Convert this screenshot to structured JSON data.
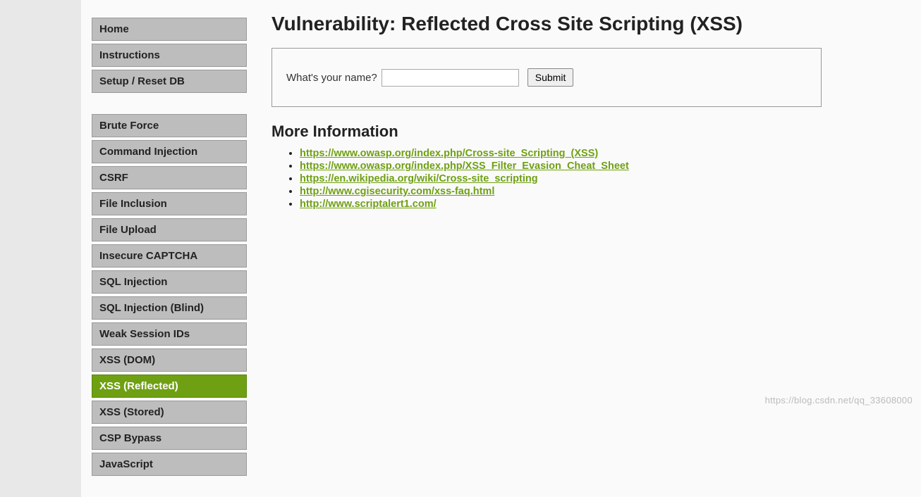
{
  "sidebar": {
    "group1": [
      {
        "label": "Home",
        "name": "nav-home"
      },
      {
        "label": "Instructions",
        "name": "nav-instructions"
      },
      {
        "label": "Setup / Reset DB",
        "name": "nav-setup-reset-db"
      }
    ],
    "group2": [
      {
        "label": "Brute Force",
        "name": "nav-brute-force",
        "selected": false
      },
      {
        "label": "Command Injection",
        "name": "nav-command-injection",
        "selected": false
      },
      {
        "label": "CSRF",
        "name": "nav-csrf",
        "selected": false
      },
      {
        "label": "File Inclusion",
        "name": "nav-file-inclusion",
        "selected": false
      },
      {
        "label": "File Upload",
        "name": "nav-file-upload",
        "selected": false
      },
      {
        "label": "Insecure CAPTCHA",
        "name": "nav-insecure-captcha",
        "selected": false
      },
      {
        "label": "SQL Injection",
        "name": "nav-sql-injection",
        "selected": false
      },
      {
        "label": "SQL Injection (Blind)",
        "name": "nav-sql-injection-blind",
        "selected": false
      },
      {
        "label": "Weak Session IDs",
        "name": "nav-weak-session-ids",
        "selected": false
      },
      {
        "label": "XSS (DOM)",
        "name": "nav-xss-dom",
        "selected": false
      },
      {
        "label": "XSS (Reflected)",
        "name": "nav-xss-reflected",
        "selected": true
      },
      {
        "label": "XSS (Stored)",
        "name": "nav-xss-stored",
        "selected": false
      },
      {
        "label": "CSP Bypass",
        "name": "nav-csp-bypass",
        "selected": false
      },
      {
        "label": "JavaScript",
        "name": "nav-javascript",
        "selected": false
      }
    ]
  },
  "main": {
    "title": "Vulnerability: Reflected Cross Site Scripting (XSS)",
    "form": {
      "label": "What's your name?",
      "input_value": "",
      "submit_label": "Submit"
    },
    "more_info_heading": "More Information",
    "links": [
      "https://www.owasp.org/index.php/Cross-site_Scripting_(XSS)",
      "https://www.owasp.org/index.php/XSS_Filter_Evasion_Cheat_Sheet",
      "https://en.wikipedia.org/wiki/Cross-site_scripting",
      "http://www.cgisecurity.com/xss-faq.html",
      "http://www.scriptalert1.com/"
    ]
  },
  "watermark": "https://blog.csdn.net/qq_33608000",
  "colors": {
    "accent": "#6fa013",
    "nav_bg": "#bdbdbd",
    "page_bg": "#e8e8e8"
  }
}
